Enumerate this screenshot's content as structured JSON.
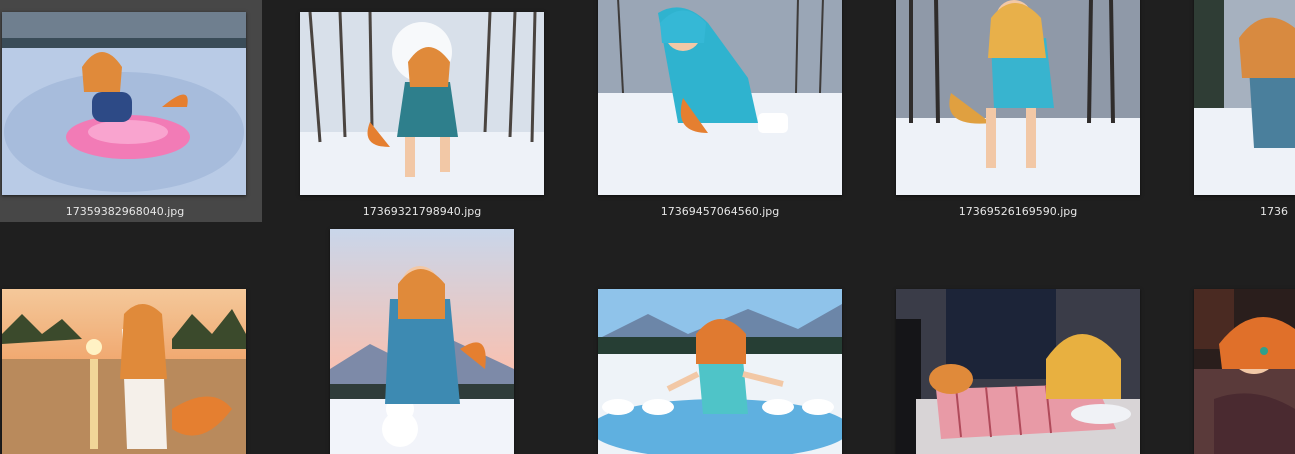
{
  "view": "Large icons",
  "files": [
    {
      "name": "17359382968040.jpg",
      "selected": true,
      "scene": "frozen-lake-pink-float"
    },
    {
      "name": "17369321798940.jpg",
      "selected": false,
      "scene": "snowy-forest-blue-coat"
    },
    {
      "name": "17369457064560.jpg",
      "selected": false,
      "scene": "snow-crawling-blue-hoodie"
    },
    {
      "name": "17369526169590.jpg",
      "selected": false,
      "scene": "snowy-forest-throwing"
    },
    {
      "name": "1736",
      "selected": false,
      "scene": "snow-kneeling-partial"
    },
    {
      "name": "",
      "selected": false,
      "scene": "sunset-lake"
    },
    {
      "name": "",
      "selected": false,
      "scene": "snowman-sunset"
    },
    {
      "name": "",
      "selected": false,
      "scene": "icy-pool-mountains"
    },
    {
      "name": "",
      "selected": false,
      "scene": "bedroom-lying-plaid"
    },
    {
      "name": "",
      "selected": false,
      "scene": "bed-lying-partial"
    }
  ],
  "colors": {
    "background": "#1f1f1f",
    "selected_tile": "#474747",
    "caption_text": "#e6e6e6"
  }
}
